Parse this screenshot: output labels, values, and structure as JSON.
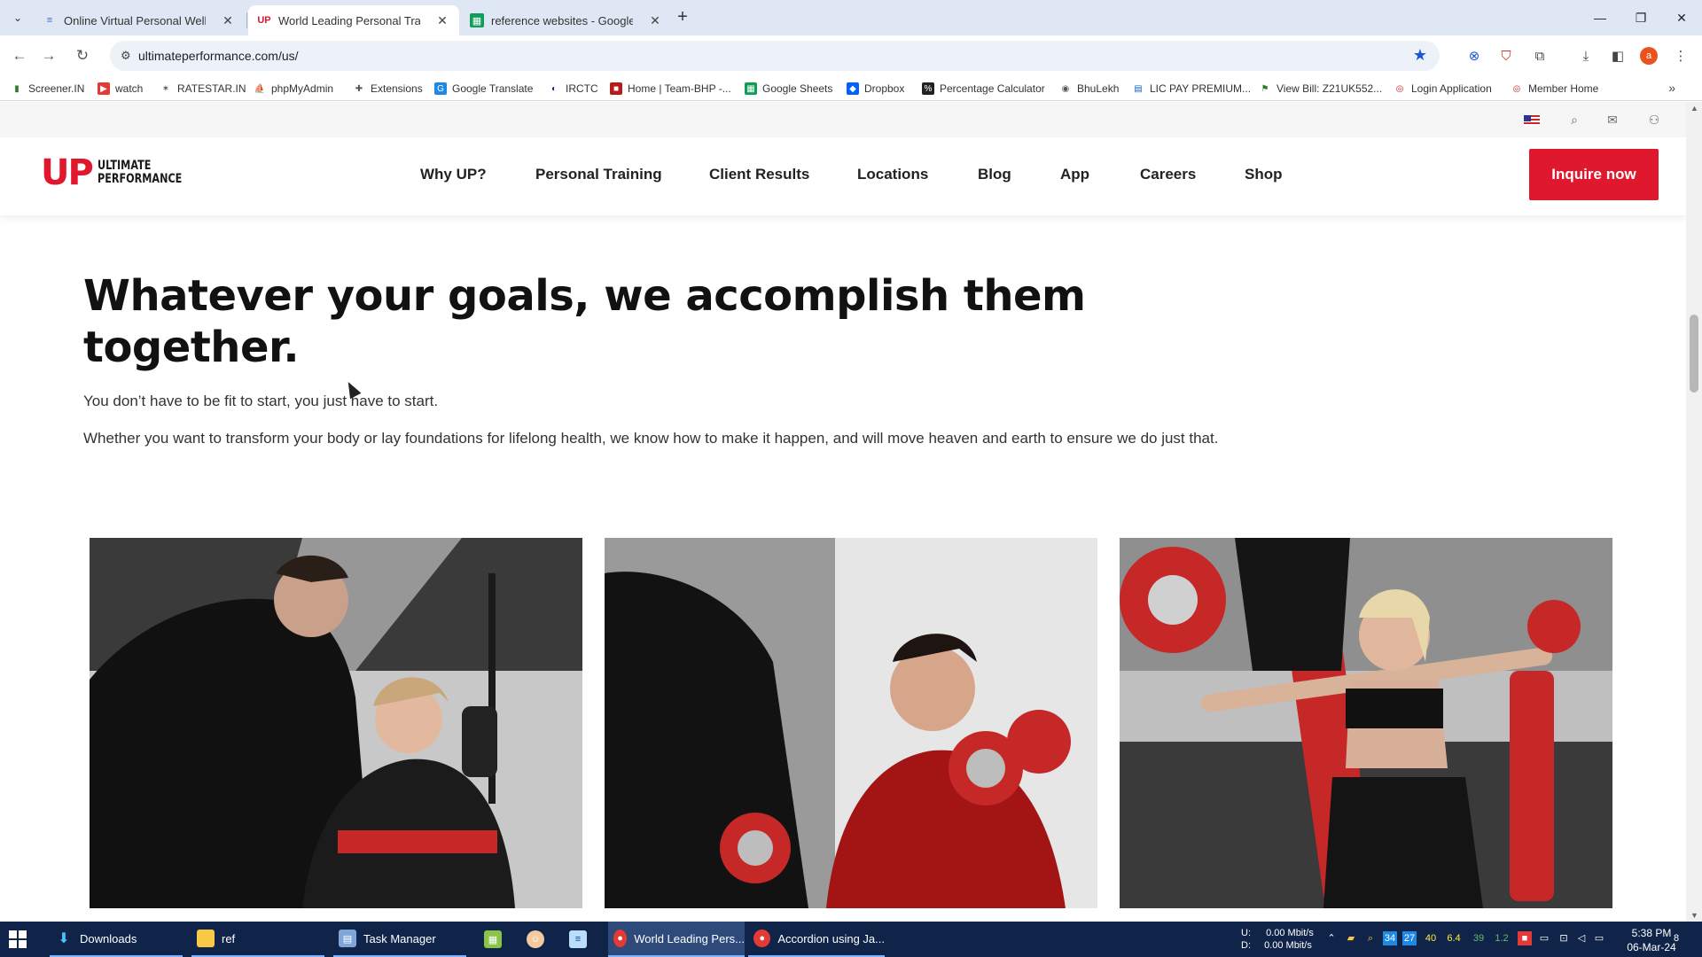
{
  "browser": {
    "tabs": [
      {
        "title": "Online Virtual Personal Wellness",
        "icon": "ribbon-icon",
        "active": false
      },
      {
        "title": "World Leading Personal Trainers",
        "icon": "up-logo-icon",
        "active": true
      },
      {
        "title": "reference websites - Google Sheets",
        "icon": "sheets-icon",
        "active": false
      }
    ],
    "url": "ultimateperformance.com/us/",
    "bookmarks": [
      {
        "label": "Screener.IN",
        "icon": "bar-chart-icon",
        "color": "#2e7d32"
      },
      {
        "label": "watch",
        "icon": "youtube-icon",
        "color": "#e53935"
      },
      {
        "label": "RATESTAR.IN",
        "icon": "star-icon",
        "color": "#555555"
      },
      {
        "label": "phpMyAdmin",
        "icon": "sailboat-icon",
        "color": "#f57c00"
      },
      {
        "label": "Extensions",
        "icon": "puzzle-icon",
        "color": "#555555"
      },
      {
        "label": "Google Translate",
        "icon": "translate-icon",
        "color": "#1e88e5"
      },
      {
        "label": "IRCTC",
        "icon": "train-icon",
        "color": "#1a237e"
      },
      {
        "label": "Home | Team-BHP -...",
        "icon": "bhp-icon",
        "color": "#b71c1c"
      },
      {
        "label": "Google Sheets",
        "icon": "sheets-icon",
        "color": "#0f9d58"
      },
      {
        "label": "Dropbox",
        "icon": "dropbox-icon",
        "color": "#0061fe"
      },
      {
        "label": "Percentage Calculator",
        "icon": "percent-icon",
        "color": "#222222"
      },
      {
        "label": "BhuLekh",
        "icon": "globe-icon",
        "color": "#555555"
      },
      {
        "label": "LIC PAY PREMIUM...",
        "icon": "lic-icon",
        "color": "#1565c0"
      },
      {
        "label": "View Bill: Z21UK552...",
        "icon": "bill-icon",
        "color": "#2e7d32"
      },
      {
        "label": "Login Application",
        "icon": "login-icon",
        "color": "#c62828"
      },
      {
        "label": "Member Home",
        "icon": "member-icon",
        "color": "#c62828"
      }
    ]
  },
  "site": {
    "brand_color": "#e0182d",
    "logo_mark": "UP",
    "logo_line1": "ULTIMATE",
    "logo_line2": "PERFORMANCE",
    "nav": [
      "Why UP?",
      "Personal Training",
      "Client Results",
      "Locations",
      "Blog",
      "App",
      "Careers",
      "Shop"
    ],
    "cta": "Inquire now",
    "headline_line1": "Whatever your goals, we accomplish them",
    "headline_line2": "together.",
    "para1": "You don’t have to be fit to start, you just have to start.",
    "para2": "Whether you want to transform your body or lay foundations for lifelong health, we know how to make it happen, and will move heaven and earth to ensure we do just that."
  },
  "taskbar": {
    "items": [
      {
        "label": "Downloads",
        "icon": "download-folder-icon"
      },
      {
        "label": "ref",
        "icon": "folder-icon"
      },
      {
        "label": "Task Manager",
        "icon": "task-manager-icon"
      },
      {
        "label": "",
        "icon": "spreadsheet-app-icon"
      },
      {
        "label": "",
        "icon": "face-app-icon"
      },
      {
        "label": "",
        "icon": "notepad-icon"
      },
      {
        "label": "World Leading Pers...",
        "icon": "chrome-icon"
      },
      {
        "label": "Accordion using Ja...",
        "icon": "chrome-icon"
      }
    ],
    "net_up_label": "U:",
    "net_down_label": "D:",
    "net_up": "0.00 Mbit/s",
    "net_down": "0.00 Mbit/s",
    "tray_numbers": [
      "40",
      "6.4",
      "39",
      "1.2"
    ],
    "time": "5:38 PM",
    "date": "06-Mar-24",
    "notifications": "8"
  }
}
